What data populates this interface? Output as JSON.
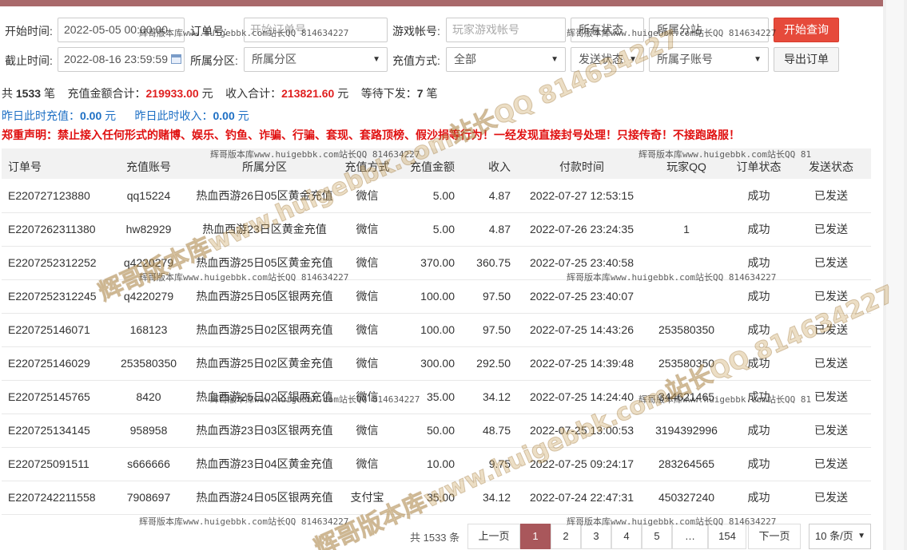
{
  "filters": {
    "start_label": "开始时间:",
    "start_value": "2022-05-05 00:00:00",
    "order_label": "订单号:",
    "order_placeholder": "开始订单号",
    "game_label": "游戏帐号:",
    "game_placeholder": "玩家游戏帐号",
    "status_select": "所有状态",
    "sub_select": "所属分站",
    "query_button": "开始查询",
    "end_label": "截止时间:",
    "end_value": "2022-08-16 23:59:59",
    "zone_label": "所属分区:",
    "zone_select": "所属分区",
    "pay_label": "充值方式:",
    "pay_select": "全部",
    "send_select": "发送状态",
    "subaccount_select": "所属子账号",
    "export_button": "导出订单"
  },
  "stats": {
    "total_prefix": "共",
    "total_count": "1533",
    "total_suffix": "笔",
    "amount_label": "充值金额合计：",
    "amount_value": "219933.00",
    "amount_unit": "元",
    "income_label": "收入合计：",
    "income_value": "213821.60",
    "income_unit": "元",
    "pending_label": "等待下发：",
    "pending_value": "7",
    "pending_unit": "笔",
    "yday_recharge_label": "昨日此时充值：",
    "yday_recharge_value": "0.00",
    "yday_recharge_unit": "元",
    "yday_income_label": "昨日此时收入：",
    "yday_income_value": "0.00",
    "yday_income_unit": "元"
  },
  "notice": "郑重声明：禁止接入任何形式的赌博、娱乐、钓鱼、诈骗、行骗、套现、套路顶榜、假沙捐等行为！一经发现直接封号处理！只接传奇！不接跑路服！",
  "table": {
    "headers": [
      "订单号",
      "充值账号",
      "所属分区",
      "充值方式",
      "充值金额",
      "收入",
      "付款时间",
      "玩家QQ",
      "订单状态",
      "发送状态"
    ],
    "rows": [
      [
        "E220727123880",
        "qq15224",
        "热血西游26日05区黄金充值",
        "微信",
        "5.00",
        "4.87",
        "2022-07-27 12:53:15",
        "",
        "成功",
        "已发送"
      ],
      [
        "E2207262311380",
        "hw82929",
        "热血西游23日区黄金充值",
        "微信",
        "5.00",
        "4.87",
        "2022-07-26 23:24:35",
        "1",
        "成功",
        "已发送"
      ],
      [
        "E2207252312252",
        "q4220279",
        "热血西游25日05区黄金充值",
        "微信",
        "370.00",
        "360.75",
        "2022-07-25 23:40:58",
        "",
        "成功",
        "已发送"
      ],
      [
        "E2207252312245",
        "q4220279",
        "热血西游25日05区银两充值",
        "微信",
        "100.00",
        "97.50",
        "2022-07-25 23:40:07",
        "",
        "成功",
        "已发送"
      ],
      [
        "E220725146071",
        "168123",
        "热血西游25日02区银两充值",
        "微信",
        "100.00",
        "97.50",
        "2022-07-25 14:43:26",
        "253580350",
        "成功",
        "已发送"
      ],
      [
        "E220725146029",
        "253580350",
        "热血西游25日02区黄金充值",
        "微信",
        "300.00",
        "292.50",
        "2022-07-25 14:39:48",
        "253580350",
        "成功",
        "已发送"
      ],
      [
        "E220725145765",
        "8420",
        "热血西游25日02区银两充值",
        "微信",
        "35.00",
        "34.12",
        "2022-07-25 14:24:40",
        "344621465",
        "成功",
        "已发送"
      ],
      [
        "E220725134145",
        "958958",
        "热血西游23日03区银两充值",
        "微信",
        "50.00",
        "48.75",
        "2022-07-25 13:00:53",
        "3194392996",
        "成功",
        "已发送"
      ],
      [
        "E220725091511",
        "s666666",
        "热血西游23日04区黄金充值",
        "微信",
        "10.00",
        "9.75",
        "2022-07-25 09:24:17",
        "283264565",
        "成功",
        "已发送"
      ],
      [
        "E2207242211558",
        "7908697",
        "热血西游24日05区银两充值",
        "支付宝",
        "35.00",
        "34.12",
        "2022-07-24 22:47:31",
        "450327240",
        "成功",
        "已发送"
      ]
    ]
  },
  "pager": {
    "total": "共 1533 条",
    "prev": "上一页",
    "p1": "1",
    "p2": "2",
    "p3": "3",
    "p4": "4",
    "p5": "5",
    "ellipsis": "…",
    "last": "154",
    "next": "下一页",
    "size": "10 条/页"
  },
  "watermark": {
    "small": "辉哥版本库www.huigebbk.com站长QQ 814634227",
    "small_cut": "辉哥版本库www.huigebbk.com站长QQ 81",
    "big": "辉哥版本库www.huigebbk.com站长QQ 814634227"
  },
  "colors": {
    "accent": "#a9575b",
    "primary_button": "#e64a3b",
    "money_red": "#e02020",
    "link_blue": "#1d6fc4"
  }
}
